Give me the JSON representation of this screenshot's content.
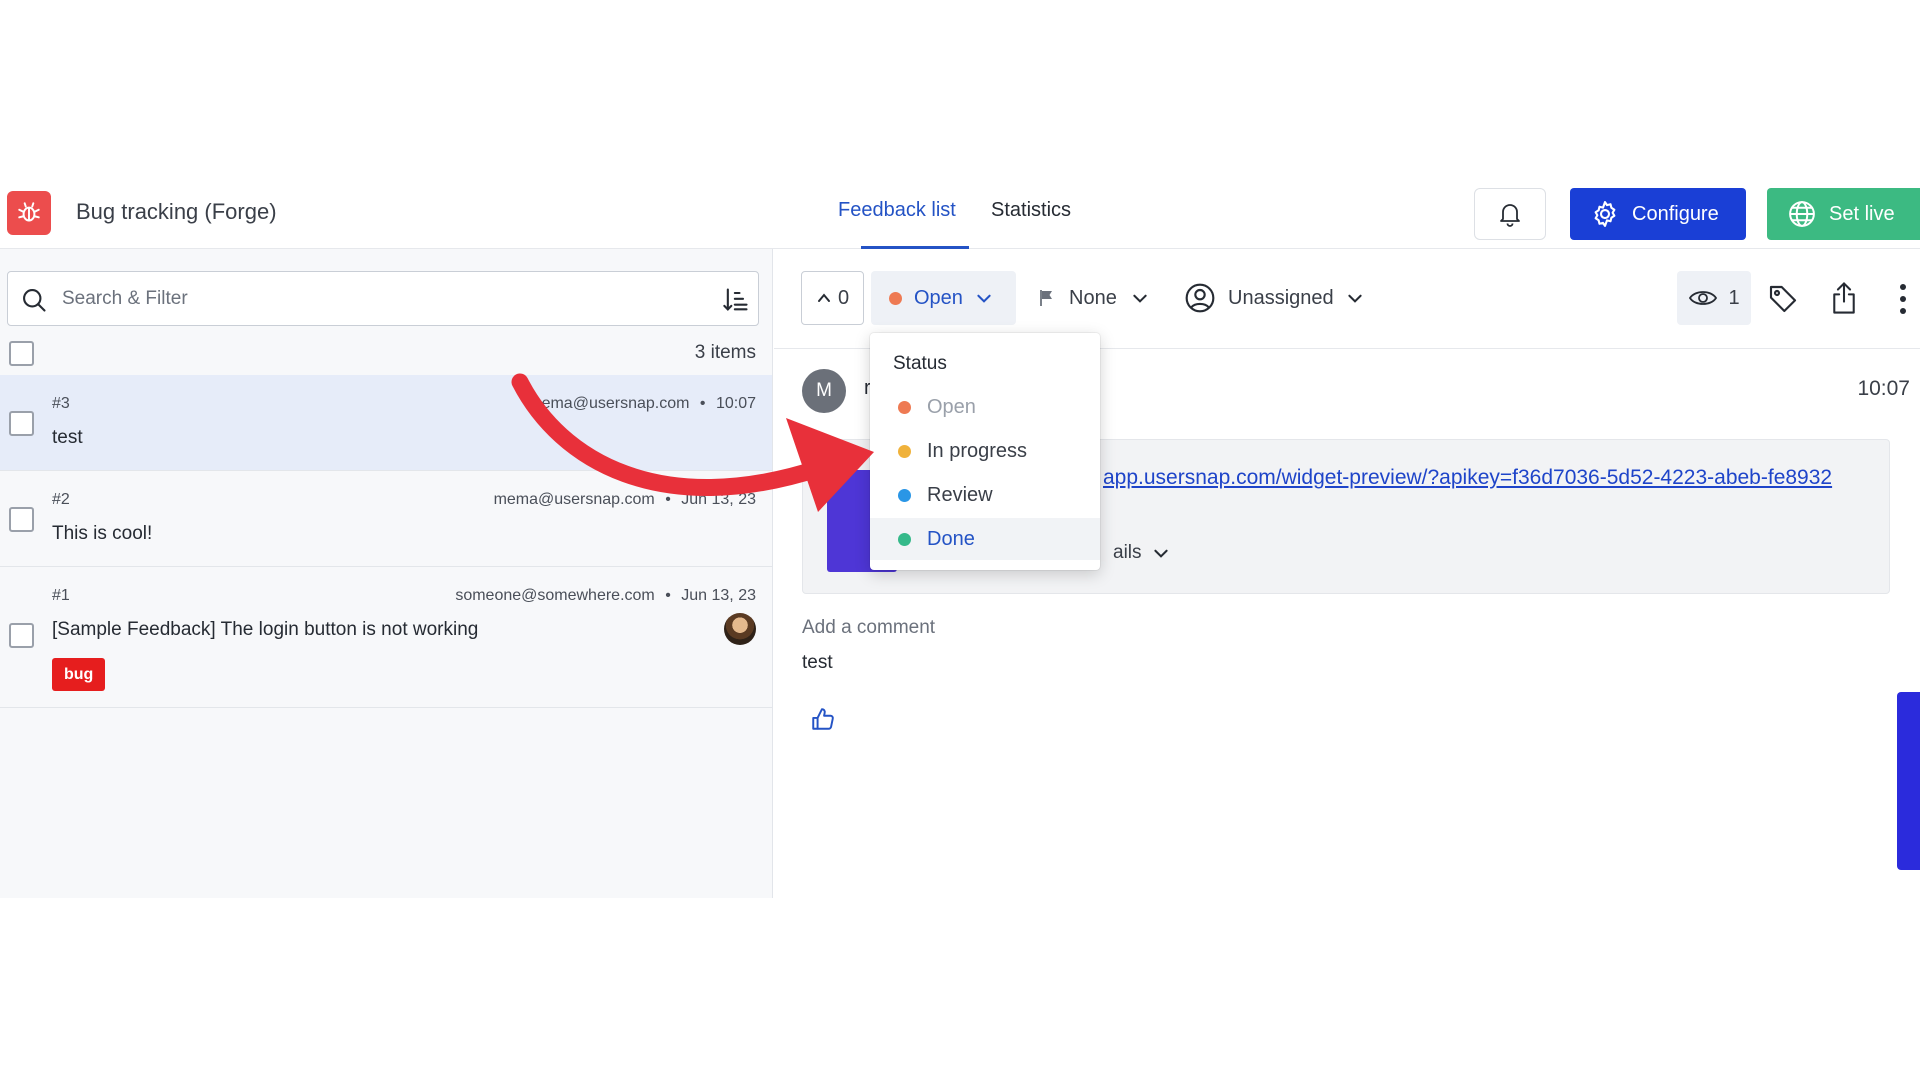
{
  "header": {
    "app_title": "Bug tracking (Forge)",
    "tabs": [
      {
        "label": "Feedback list",
        "active": true
      },
      {
        "label": "Statistics",
        "active": false
      }
    ],
    "configure_label": "Configure",
    "set_live_label": "Set live"
  },
  "list": {
    "search_placeholder": "Search & Filter",
    "item_count": "3 items",
    "items": [
      {
        "number": "#3",
        "email": "mema@usersnap.com",
        "time": "10:07",
        "title": "test",
        "selected": true
      },
      {
        "number": "#2",
        "email": "mema@usersnap.com",
        "time": "Jun 13, 23",
        "title": "This is cool!"
      },
      {
        "number": "#1",
        "email": "someone@somewhere.com",
        "time": "Jun 13, 23",
        "title": "[Sample Feedback] The login button is not working",
        "tag": "bug"
      }
    ],
    "separator": "•"
  },
  "detail": {
    "votes": "0",
    "status": "Open",
    "priority": "None",
    "assignee": "Unassigned",
    "views": "1",
    "message": {
      "avatar_letter": "M",
      "author": "r",
      "time": "10:07",
      "link": "app.usersnap.com/widget-preview/?apikey=f36d7036-5d52-4223-abeb-fe8932",
      "details_label": "ails"
    },
    "comment_label": "Add a comment",
    "comment_text": "test"
  },
  "status_dropdown": {
    "title": "Status",
    "options": [
      {
        "label": "Open",
        "color": "#ee7a53",
        "state": "current"
      },
      {
        "label": "In progress",
        "color": "#f0b23b"
      },
      {
        "label": "Review",
        "color": "#2a96e6"
      },
      {
        "label": "Done",
        "color": "#35b98a",
        "state": "hover"
      }
    ]
  },
  "colors": {
    "accent": "#2453c5",
    "configure": "#1a3fd6",
    "set_live": "#3cba82",
    "logo": "#ec4d4d",
    "bug_tag": "#e61e1e",
    "arrow": "#e8303a"
  }
}
